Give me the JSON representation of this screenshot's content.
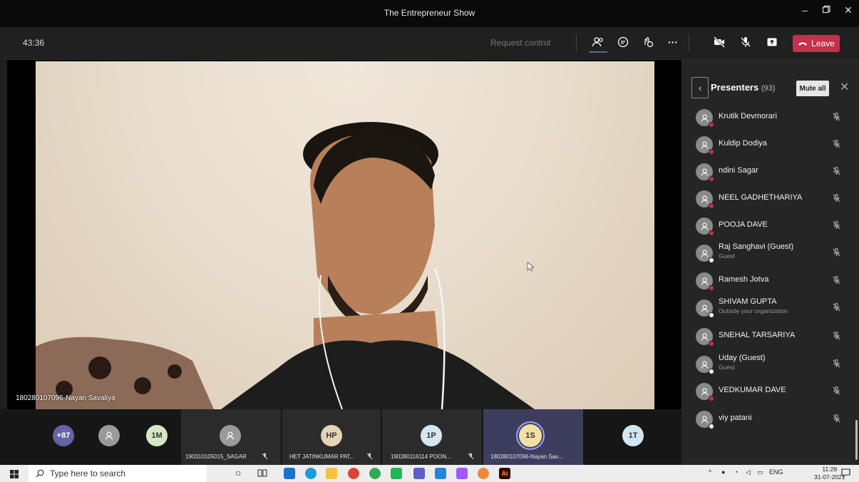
{
  "window": {
    "title": "The Entrepreneur Show"
  },
  "toolbar": {
    "timer": "43:36",
    "request_control": "Request control",
    "leave_label": "Leave"
  },
  "stage": {
    "presenter_name": "180280107096-Nayan Savaliya"
  },
  "panel": {
    "title": "Presenters",
    "count": "(93)",
    "mute_all_label": "Mute all",
    "participants": [
      {
        "name": "Krutik Devmorari",
        "sub": "",
        "status": "red"
      },
      {
        "name": "Kuldip Dodiya",
        "sub": "",
        "status": "red"
      },
      {
        "name": "ndini Sagar",
        "sub": "",
        "status": "red"
      },
      {
        "name": "NEEL GADHETHARIYA",
        "sub": "",
        "status": "red"
      },
      {
        "name": "POOJA DAVE",
        "sub": "",
        "status": "red"
      },
      {
        "name": "Raj Sanghavi (Guest)",
        "sub": "Guest",
        "status": "white"
      },
      {
        "name": "Ramesh Jotva",
        "sub": "",
        "status": "red"
      },
      {
        "name": "SHIVAM GUPTA",
        "sub": "Outside your organization",
        "status": "white"
      },
      {
        "name": "SNEHAL TARSARIYA",
        "sub": "",
        "status": "red"
      },
      {
        "name": "Uday (Guest)",
        "sub": "Guest",
        "status": "white"
      },
      {
        "name": "VEDKUMAR DAVE",
        "sub": "",
        "status": "red"
      },
      {
        "name": "viy patani",
        "sub": "",
        "status": "white"
      }
    ]
  },
  "strip": {
    "overflow": "+87",
    "tiles": [
      {
        "initials": "1M",
        "label": ""
      },
      {
        "initials": "",
        "label": "190310105015_SAGAR"
      },
      {
        "initials": "HP",
        "label": "HET JATINKUMAR PAT..."
      },
      {
        "initials": "1P",
        "label": "190280116114 POON..."
      },
      {
        "initials": "1S",
        "label": "180280107096-Nayan Sav..."
      },
      {
        "initials": "1T",
        "label": ""
      }
    ]
  },
  "taskbar": {
    "search_placeholder": "Type here to search",
    "language": "ENG",
    "time": "11:28",
    "date": "31-07-2021"
  },
  "colors": {
    "accent": "#6264a7",
    "leave_red": "#c4314b",
    "status_red": "#c4314b"
  }
}
